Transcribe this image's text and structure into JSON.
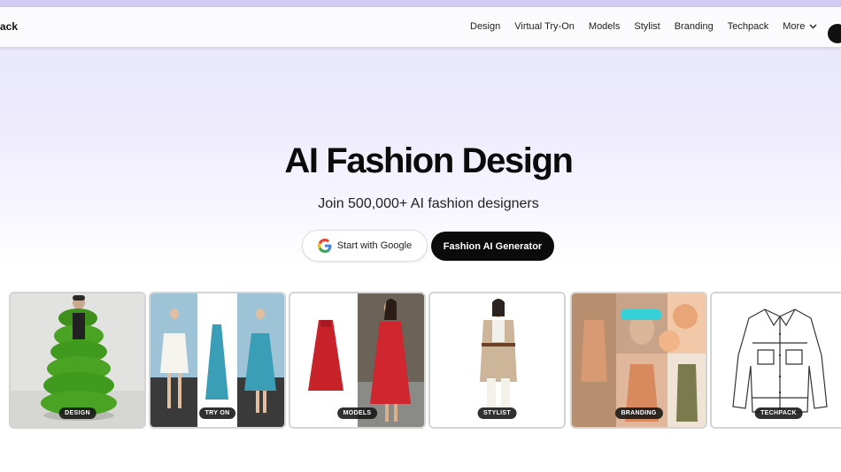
{
  "nav": {
    "brand": "ack",
    "links": [
      "Design",
      "Virtual Try-On",
      "Models",
      "Stylist",
      "Branding",
      "Techpack"
    ],
    "more": "More"
  },
  "hero": {
    "title": "AI Fashion Design",
    "subtitle": "Join 500,000+ AI fashion designers",
    "google_button": "Start with Google",
    "generator_button": "Fashion AI Generator"
  },
  "cards": [
    {
      "badge": "DESIGN",
      "image": "green-puffer-coat-model"
    },
    {
      "badge": "TRY ON",
      "image": "virtual-try-on-dresses"
    },
    {
      "badge": "MODELS",
      "image": "red-dress-model"
    },
    {
      "badge": "STYLIST",
      "image": "beige-trench-outfit"
    },
    {
      "badge": "BRANDING",
      "image": "floral-mood-board"
    },
    {
      "badge": "TECHPACK",
      "image": "denim-jacket-sketch"
    }
  ],
  "colors": {
    "accent_dark": "#0b0b0b",
    "hero_gradient_top": "#e8e6fb",
    "badge_bg": "#141414"
  }
}
